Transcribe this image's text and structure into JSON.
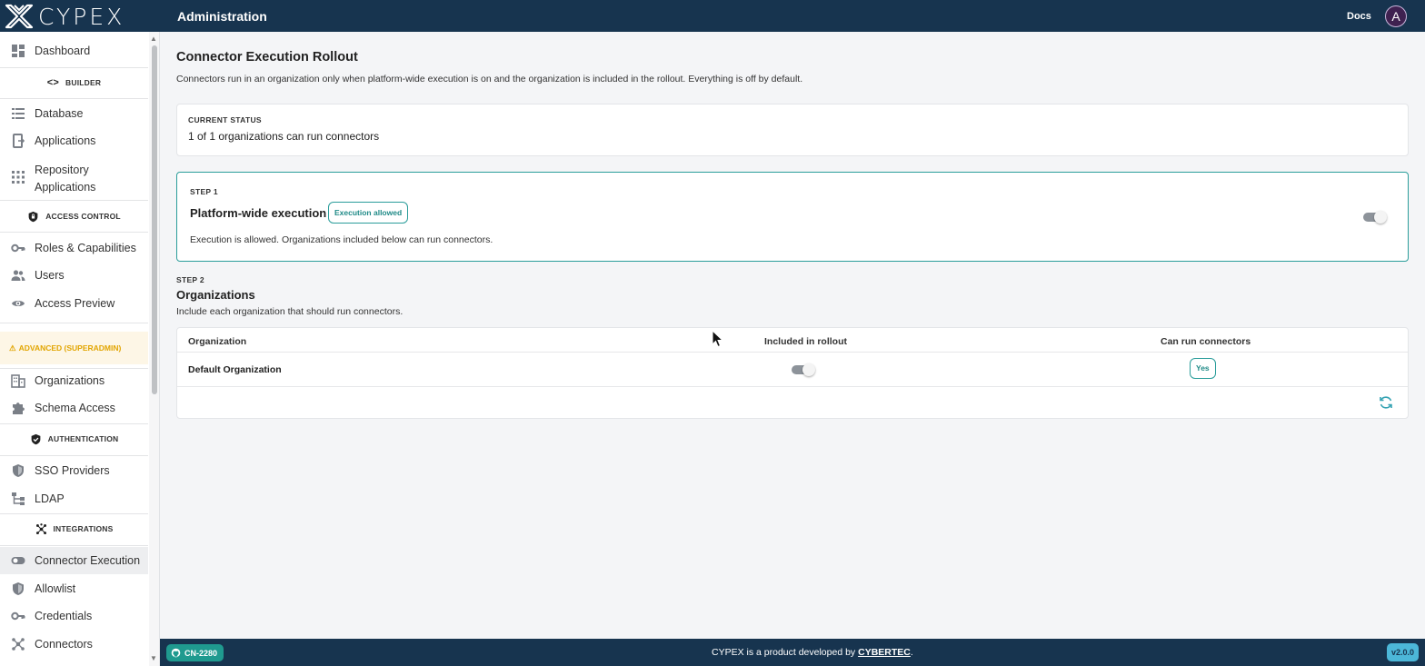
{
  "topbar": {
    "logo_text": "CYPEX",
    "title": "Administration",
    "docs_label": "Docs",
    "avatar_letter": "A"
  },
  "sidebar": {
    "dashboard": "Dashboard",
    "builder_section": "BUILDER",
    "database": "Database",
    "applications": "Applications",
    "repository_line1": "Repository",
    "repository_line2": "Applications",
    "access_control_section": "ACCESS CONTROL",
    "roles": "Roles & Capabilities",
    "users": "Users",
    "access_preview": "Access Preview",
    "advanced_section": "ADVANCED (SUPERADMIN)",
    "organizations": "Organizations",
    "schema_access": "Schema Access",
    "authentication_section": "AUTHENTICATION",
    "sso": "SSO Providers",
    "ldap": "LDAP",
    "integrations_section": "INTEGRATIONS",
    "connector_execution": "Connector Execution",
    "allowlist": "Allowlist",
    "credentials": "Credentials",
    "connectors": "Connectors"
  },
  "main": {
    "title": "Connector Execution Rollout",
    "description": "Connectors run in an organization only when platform-wide execution is on and the organization is included in the rollout. Everything is off by default.",
    "status": {
      "label": "CURRENT STATUS",
      "value": "1 of 1 organizations can run connectors"
    },
    "step1": {
      "label": "STEP 1",
      "title": "Platform-wide execution",
      "badge": "Execution allowed",
      "description": "Execution is allowed. Organizations included below can run connectors.",
      "toggle_on": true
    },
    "step2": {
      "label": "STEP 2",
      "title": "Organizations",
      "description": "Include each organization that should run connectors.",
      "columns": [
        "Organization",
        "Included in rollout",
        "Can run connectors"
      ],
      "rows": [
        {
          "name": "Default Organization",
          "included": true,
          "can_run": "Yes"
        }
      ]
    }
  },
  "footer": {
    "branch": "CN-2280",
    "text_prefix": "CYPEX is a product developed by ",
    "link": "CYBERTEC",
    "text_suffix": ".",
    "version": "v2.0.0"
  },
  "colors": {
    "topbar": "#17344f",
    "accent_teal": "#2a9d9a",
    "advanced_bg": "#fdf6e6",
    "advanced_text": "#e2a500"
  }
}
